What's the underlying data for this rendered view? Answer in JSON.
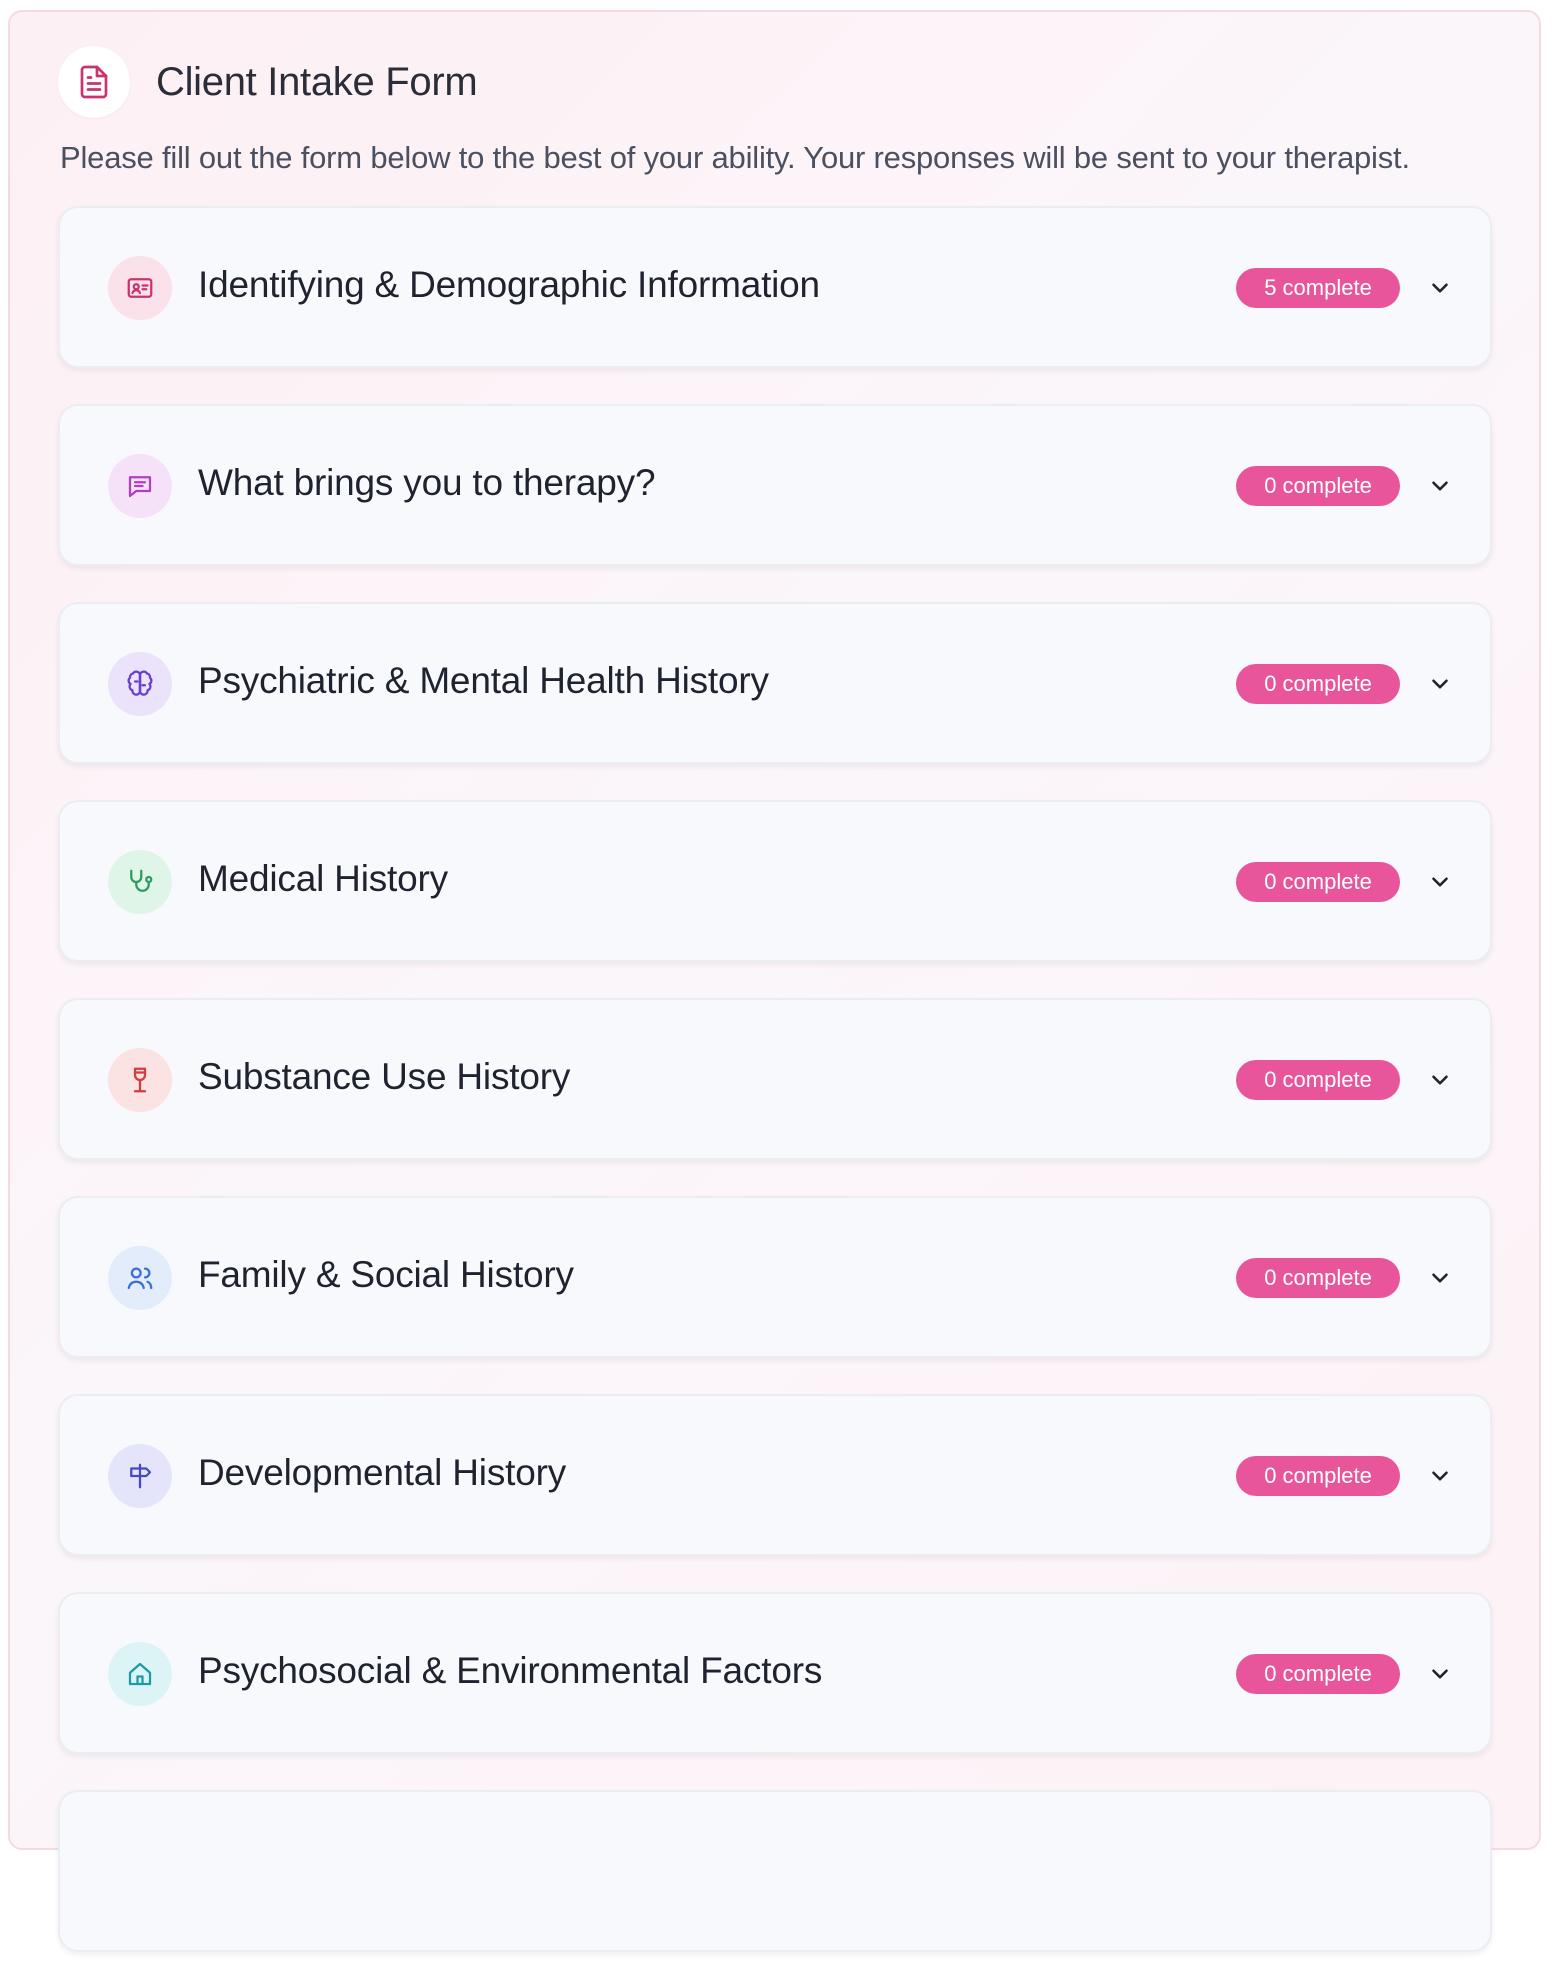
{
  "header": {
    "title": "Client Intake Form",
    "subtitle": "Please fill out the form below to the best of your ability. Your responses will be sent to your therapist.",
    "icon": "document-icon"
  },
  "colors": {
    "badge": "#e8559a",
    "accent": "#c8346f"
  },
  "sections": [
    {
      "title": "Identifying & Demographic Information",
      "badge": "5 complete",
      "icon": "id-card-icon",
      "icon_color": "#c8346f",
      "icon_bg": "#fbe1ea"
    },
    {
      "title": "What brings you to therapy?",
      "badge": "0 complete",
      "icon": "message-icon",
      "icon_color": "#b13fc1",
      "icon_bg": "#f6e2f8"
    },
    {
      "title": "Psychiatric & Mental Health History",
      "badge": "0 complete",
      "icon": "brain-icon",
      "icon_color": "#6a3fcf",
      "icon_bg": "#ebe3fb"
    },
    {
      "title": "Medical History",
      "badge": "0 complete",
      "icon": "stethoscope-icon",
      "icon_color": "#2d9b63",
      "icon_bg": "#dff5e8"
    },
    {
      "title": "Substance Use History",
      "badge": "0 complete",
      "icon": "wine-glass-icon",
      "icon_color": "#d43c3c",
      "icon_bg": "#fbe3e3"
    },
    {
      "title": "Family & Social History",
      "badge": "0 complete",
      "icon": "users-icon",
      "icon_color": "#3a6fd1",
      "icon_bg": "#e3ecfb"
    },
    {
      "title": "Developmental History",
      "badge": "0 complete",
      "icon": "signpost-icon",
      "icon_color": "#4447c8",
      "icon_bg": "#e4e5fb"
    },
    {
      "title": "Psychosocial & Environmental Factors",
      "badge": "0 complete",
      "icon": "home-icon",
      "icon_color": "#1d9aa8",
      "icon_bg": "#dcf4f6"
    },
    {
      "title": "",
      "badge": "",
      "icon": "",
      "icon_color": "#c8346f",
      "icon_bg": "#f8f9fc"
    }
  ]
}
